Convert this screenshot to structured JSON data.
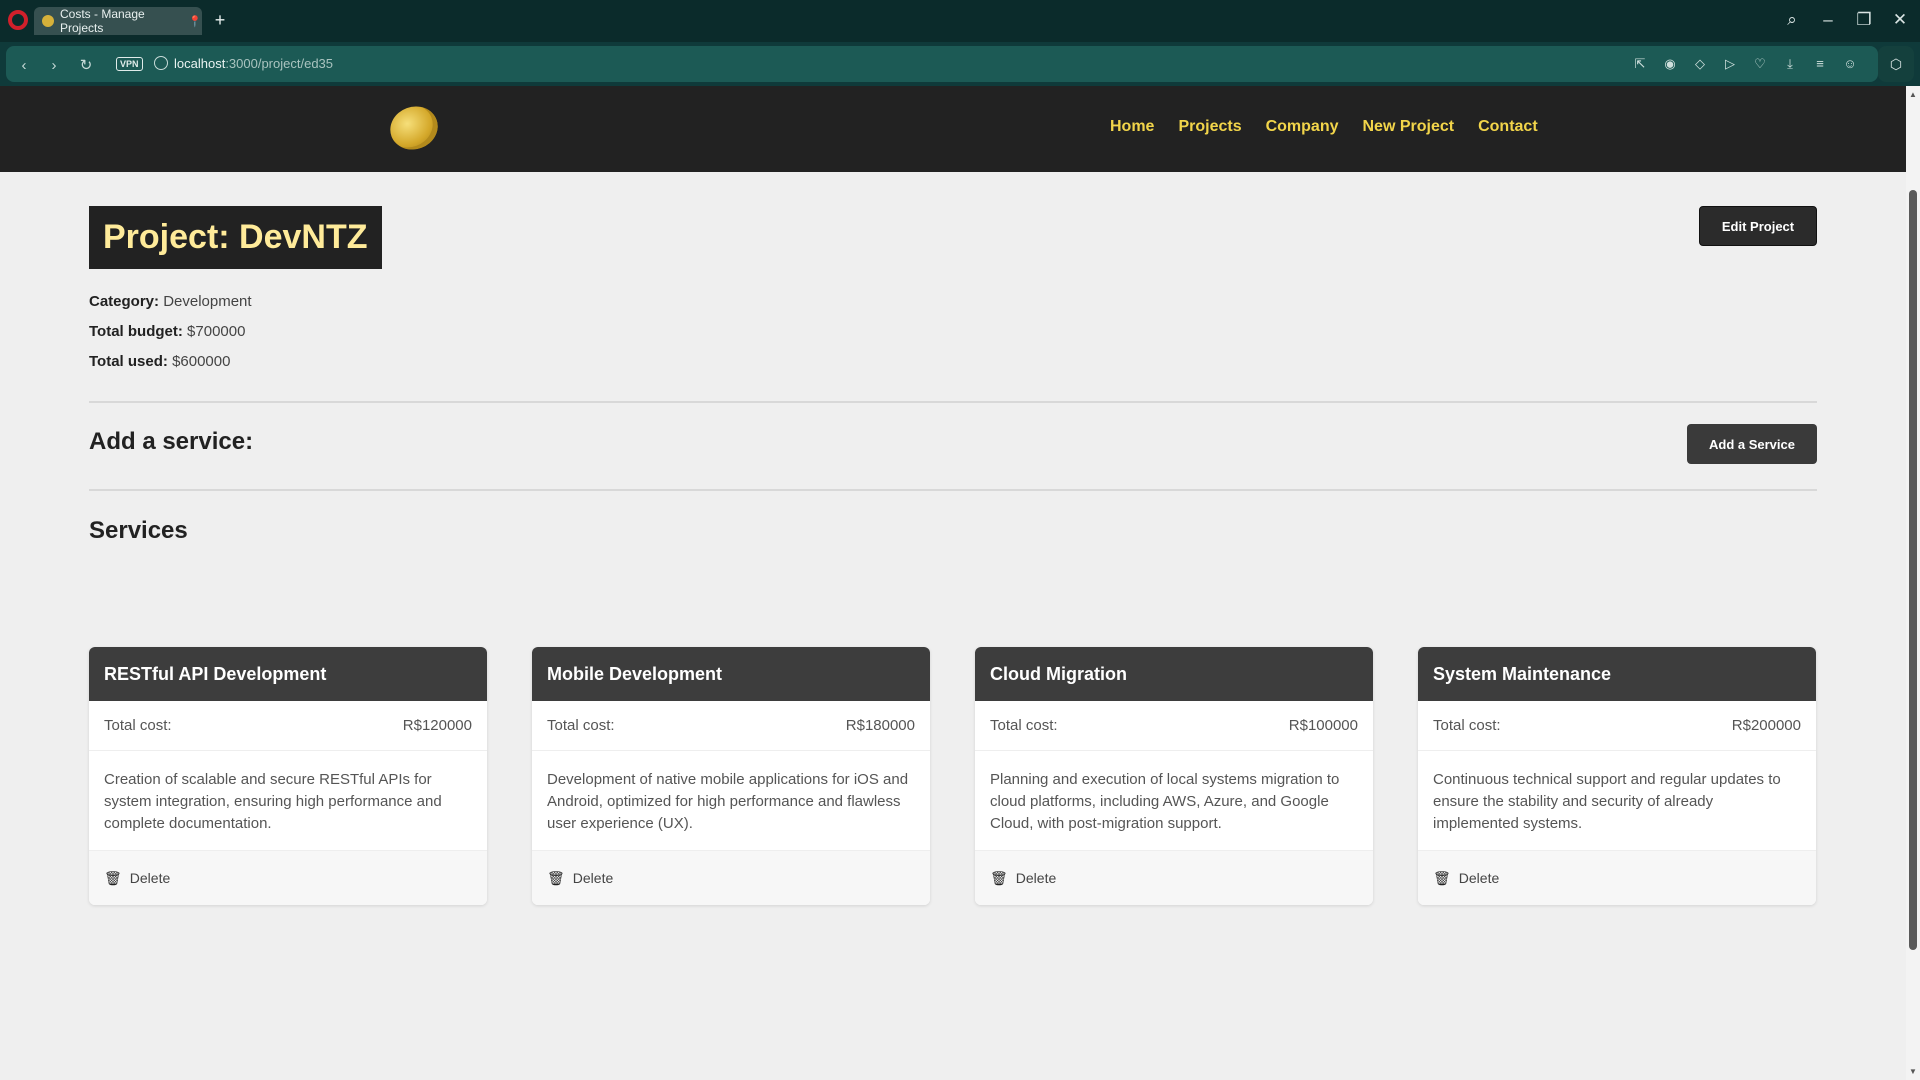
{
  "browser": {
    "tab_title": "Costs - Manage Projects",
    "tab_pin": "📍",
    "new_tab": "+",
    "vpn": "VPN",
    "url_host": "localhost",
    "url_path": ":3000/project/ed35"
  },
  "site": {
    "nav": [
      "Home",
      "Projects",
      "Company",
      "New Project",
      "Contact"
    ]
  },
  "project": {
    "title": "Project: DevNTZ",
    "edit_label": "Edit Project",
    "category_label": "Category:",
    "category": "Development",
    "budget_label": "Total budget:",
    "budget": "$700000",
    "used_label": "Total used:",
    "used": "$600000"
  },
  "add_service": {
    "heading": "Add a service:",
    "button": "Add a Service"
  },
  "services": {
    "heading": "Services",
    "cost_label": "Total cost:",
    "delete_label": "Delete",
    "items": [
      {
        "name": "RESTful API Development",
        "cost": "R$120000",
        "description": "Creation of scalable and secure RESTful APIs for system integration, ensuring high performance and complete documentation."
      },
      {
        "name": "Mobile Development",
        "cost": "R$180000",
        "description": "Development of native mobile applications for iOS and Android, optimized for high performance and flawless user experience (UX)."
      },
      {
        "name": "Cloud Migration",
        "cost": "R$100000",
        "description": "Planning and execution of local systems migration to cloud platforms, including AWS, Azure, and Google Cloud, with post-migration support."
      },
      {
        "name": "System Maintenance",
        "cost": "R$200000",
        "description": "Continuous technical support and regular updates to ensure the stability and security of already implemented systems."
      }
    ]
  },
  "colors": {
    "nav_link": "#f2d54a",
    "title_text": "#ffeb9a",
    "header_bg": "#222222",
    "card_head": "#3d3d3d"
  }
}
